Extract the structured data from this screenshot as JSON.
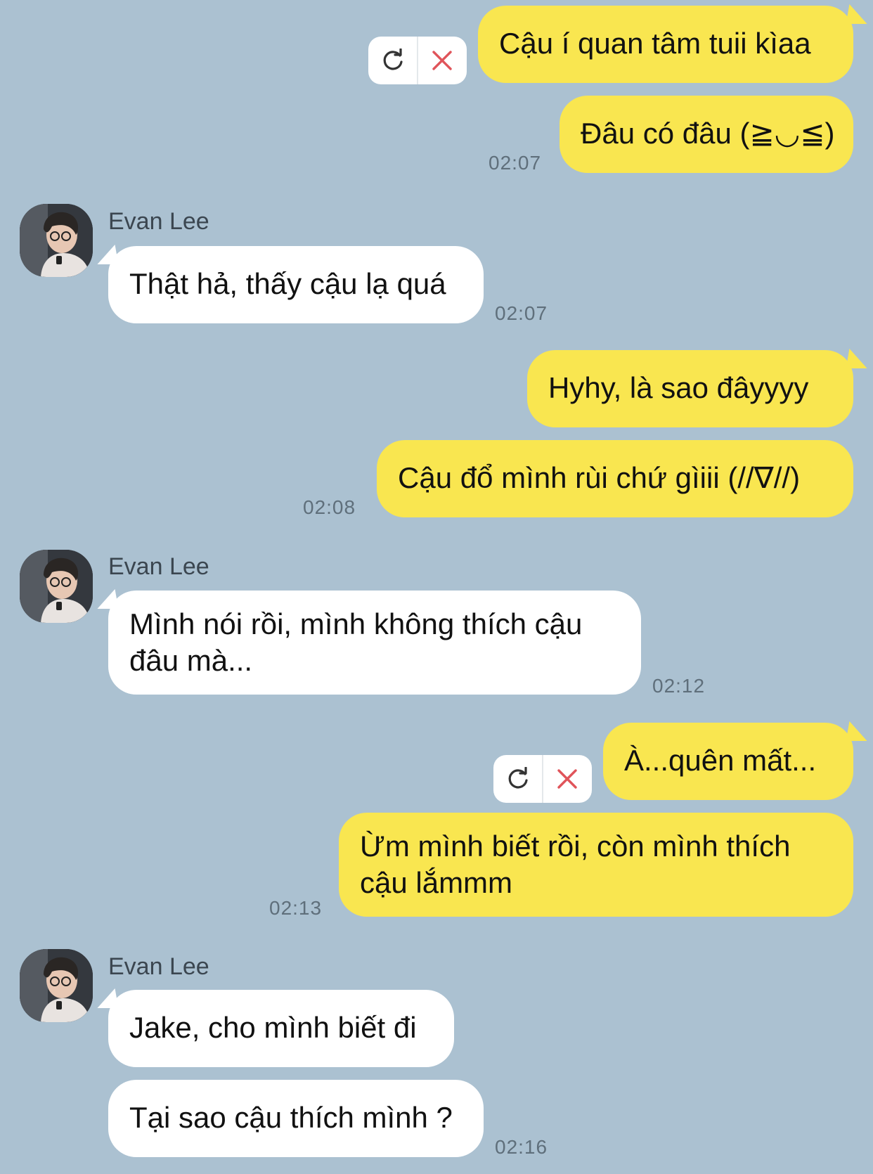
{
  "contact": {
    "name": "Evan Lee"
  },
  "colors": {
    "background": "#abc1d1",
    "outgoing": "#f9e650",
    "incoming": "#ffffff",
    "retry_icon": "#333333",
    "delete_icon": "#e0545a"
  },
  "icons": {
    "retry": "refresh-icon",
    "delete": "close-icon",
    "avatar": "contact-avatar"
  },
  "messages": [
    {
      "from": "me",
      "text": "Cậu í quan tâm tuii kìaa",
      "status": "failed"
    },
    {
      "from": "me",
      "text": "Đâu có đâu (≧◡≦)",
      "time": "02:07"
    },
    {
      "from": "them",
      "sender": "Evan Lee",
      "text": "Thật hả, thấy cậu lạ quá",
      "time": "02:07"
    },
    {
      "from": "me",
      "text": "Hyhy, là sao đâyyyy"
    },
    {
      "from": "me",
      "text": "Cậu đổ mình rùi chứ gìiii (//∇//)",
      "time": "02:08"
    },
    {
      "from": "them",
      "sender": "Evan Lee",
      "text": "Mình nói rồi, mình không thích cậu đâu mà...",
      "time": "02:12"
    },
    {
      "from": "me",
      "text": "À...quên mất...",
      "status": "failed"
    },
    {
      "from": "me",
      "text": "Ừm mình biết rồi, còn mình thích cậu lắmmm",
      "time": "02:13"
    },
    {
      "from": "them",
      "sender": "Evan Lee",
      "text": "Jake, cho mình biết đi"
    },
    {
      "from": "them",
      "text": "Tại sao cậu thích mình ?",
      "time": "02:16"
    }
  ]
}
